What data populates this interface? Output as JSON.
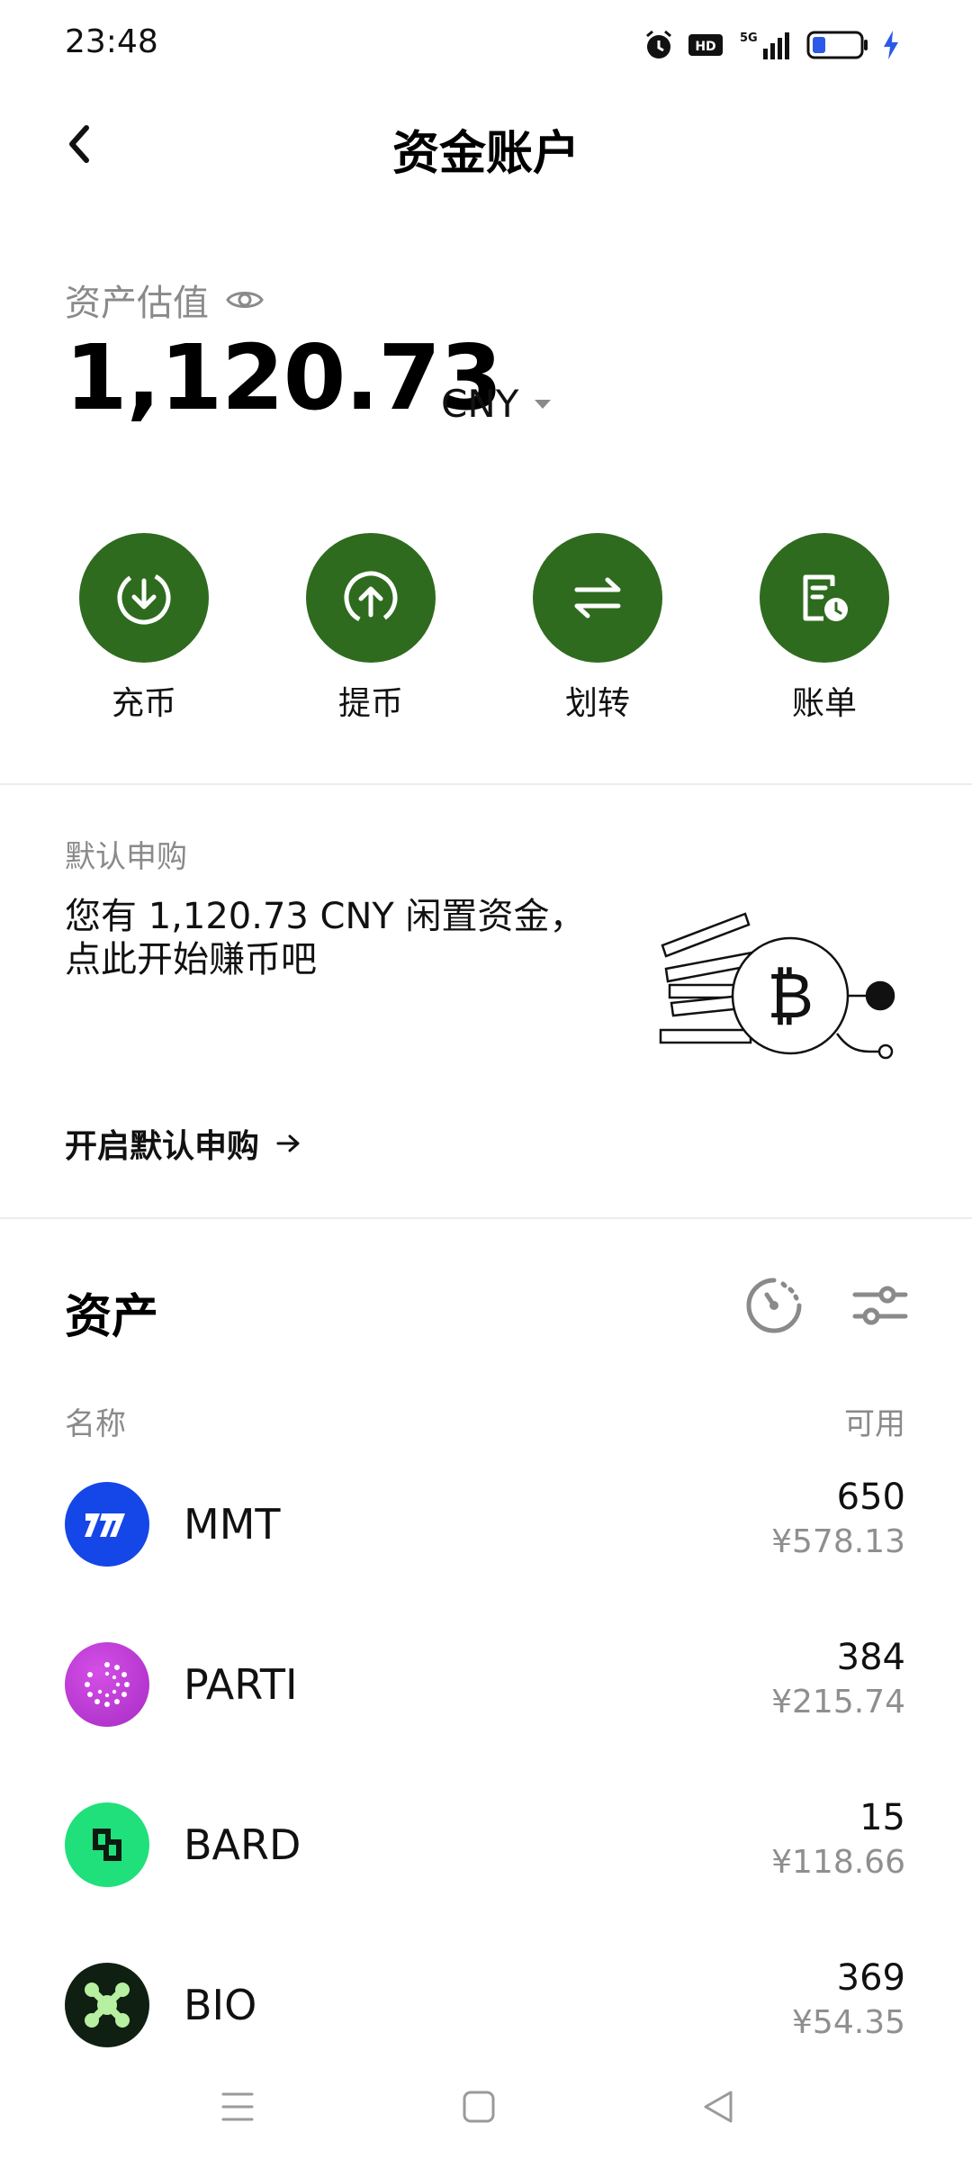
{
  "status_bar": {
    "time": "23:48",
    "icons": [
      "alarm-icon",
      "hd-icon",
      "5g-signal-icon",
      "battery-icon",
      "charging-icon"
    ]
  },
  "header": {
    "title": "资金账户"
  },
  "valuation": {
    "label": "资产估值",
    "amount": "1,120.73",
    "currency": "CNY"
  },
  "actions": [
    {
      "label": "充币",
      "icon": "deposit-icon"
    },
    {
      "label": "提币",
      "icon": "withdraw-icon"
    },
    {
      "label": "划转",
      "icon": "transfer-icon"
    },
    {
      "label": "账单",
      "icon": "bill-icon"
    }
  ],
  "subscription": {
    "label": "默认申购",
    "line1": "您有 1,120.73 CNY 闲置资金，",
    "line2": "点此开始赚币吧",
    "link": "开启默认申购"
  },
  "assets": {
    "title": "资产",
    "col_name": "名称",
    "col_available": "可用",
    "rows": [
      {
        "symbol": "MMT",
        "amount": "650",
        "cny": "¥578.13",
        "color": "#1446e8"
      },
      {
        "symbol": "PARTI",
        "amount": "384",
        "cny": "¥215.74",
        "color": "#c33fd9"
      },
      {
        "symbol": "BARD",
        "amount": "15",
        "cny": "¥118.66",
        "color": "#1fe07a"
      },
      {
        "symbol": "BIO",
        "amount": "369",
        "cny": "¥54.35",
        "color": "#0f1f12"
      }
    ]
  },
  "colors": {
    "accent_green": "#2e6b1e",
    "muted_text": "#8a8a8a"
  }
}
